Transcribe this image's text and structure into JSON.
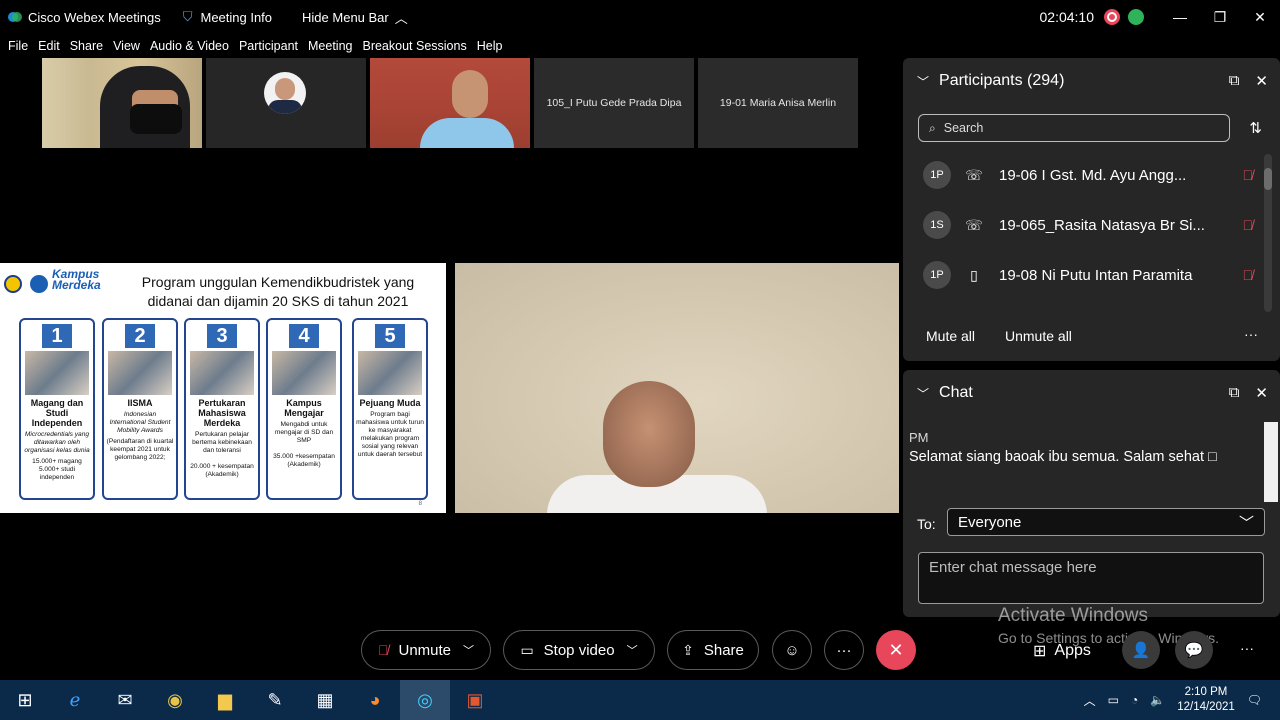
{
  "titlebar": {
    "app_name": "Cisco Webex Meetings",
    "meeting_info": "Meeting Info",
    "hide_menu": "Hide Menu Bar",
    "clock": "02:04:10",
    "minimize": "—",
    "restore": "❐",
    "close": "✕"
  },
  "menu": [
    "File",
    "Edit",
    "Share",
    "View",
    "Audio & Video",
    "Participant",
    "Meeting",
    "Breakout Sessions",
    "Help"
  ],
  "thumbnails": {
    "t4_name": "105_I Putu Gede Prada Dipa",
    "t5_name": "19-01 Maria Anisa Merlin"
  },
  "slide": {
    "logo_text_1": "Kampus",
    "logo_text_2": "Merdeka",
    "title_line1": "Program unggulan Kemendikbudristek yang",
    "title_line2": "didanai  dan dijamin 20 SKS di tahun 2021",
    "page_num": "8",
    "cards": [
      {
        "num": "1",
        "title": "Magang dan Studi Independen",
        "sub_italic": "Microcredentials yang ditawarkan oleh organisasi kelas dunia",
        "sub": "15.000+ magang 5.000+ studi independen"
      },
      {
        "num": "2",
        "title": "IISMA",
        "sub_italic": "Indonesian International Student Mobility Awards",
        "sub": "(Pendaftaran di kuartal keempat 2021 untuk gelombang 2022;"
      },
      {
        "num": "3",
        "title": "Pertukaran Mahasiswa Merdeka",
        "sub_italic": "",
        "sub": "Pertukaran pelajar bertema kebinekaan dan toleransi\n\n20.000 + kesempatan (Akademik)"
      },
      {
        "num": "4",
        "title": "Kampus Mengajar",
        "sub_italic": "",
        "sub": "Mengabdi untuk mengajar di SD dan SMP\n\n35.000 +kesempatan (Akademik)"
      },
      {
        "num": "5",
        "title": "Pejuang Muda",
        "sub_italic": "",
        "sub": "Program bagi mahasiswa untuk turun ke masyarakat melakukan program sosial yang relevan untuk daerah tersebut"
      }
    ]
  },
  "participants": {
    "header": "Participants (294)",
    "search_placeholder": "Search",
    "rows": [
      {
        "initials": "1P",
        "name": "19-06 I Gst. Md. Ayu Angg...",
        "icon": "phone-call-icon"
      },
      {
        "initials": "1S",
        "name": "19-065_Rasita Natasya Br Si...",
        "icon": "phone-call-icon"
      },
      {
        "initials": "1P",
        "name": "19-08 Ni Putu Intan Paramita",
        "icon": "mobile-icon"
      }
    ],
    "mute_all": "Mute all",
    "unmute_all": "Unmute all",
    "more": "···"
  },
  "chat": {
    "header": "Chat",
    "fragment": "PM",
    "message": "Selamat siang baoak ibu semua. Salam sehat □",
    "to_label": "To:",
    "to_value": "Everyone",
    "input_placeholder": "Enter chat message here"
  },
  "controls": {
    "unmute": "Unmute",
    "stop_video": "Stop video",
    "share": "Share",
    "more": "···",
    "apps": "Apps"
  },
  "watermark": {
    "line1": "Activate Windows",
    "line2": "Go to Settings to activate Windows."
  },
  "taskbar": {
    "time": "2:10 PM",
    "date": "12/14/2021"
  },
  "colors": {
    "end_meeting": "#e8465a",
    "panel_bg": "#262626",
    "taskbar_bg": "#0b2a4a"
  }
}
